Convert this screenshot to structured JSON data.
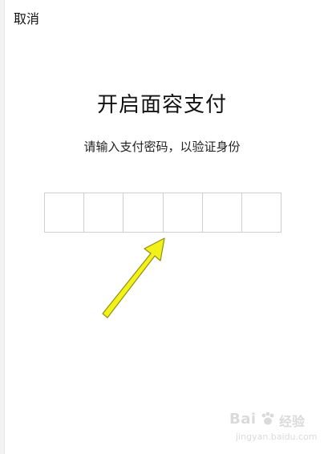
{
  "header": {
    "cancel_label": "取消"
  },
  "main": {
    "title": "开启面容支付",
    "subtitle": "请输入支付密码，以验证身份",
    "pin": {
      "length": 6,
      "filled": 0
    }
  },
  "annotation": {
    "arrow_color": "#f2f21a",
    "arrow_outline": "#8f8f12"
  },
  "watermark": {
    "brand": "Bai",
    "brand_cn": "经验",
    "url": "jingyan.baidu.com"
  },
  "colors": {
    "background": "#ffffff",
    "text": "#111111",
    "pin_border": "#cfcfcf"
  }
}
